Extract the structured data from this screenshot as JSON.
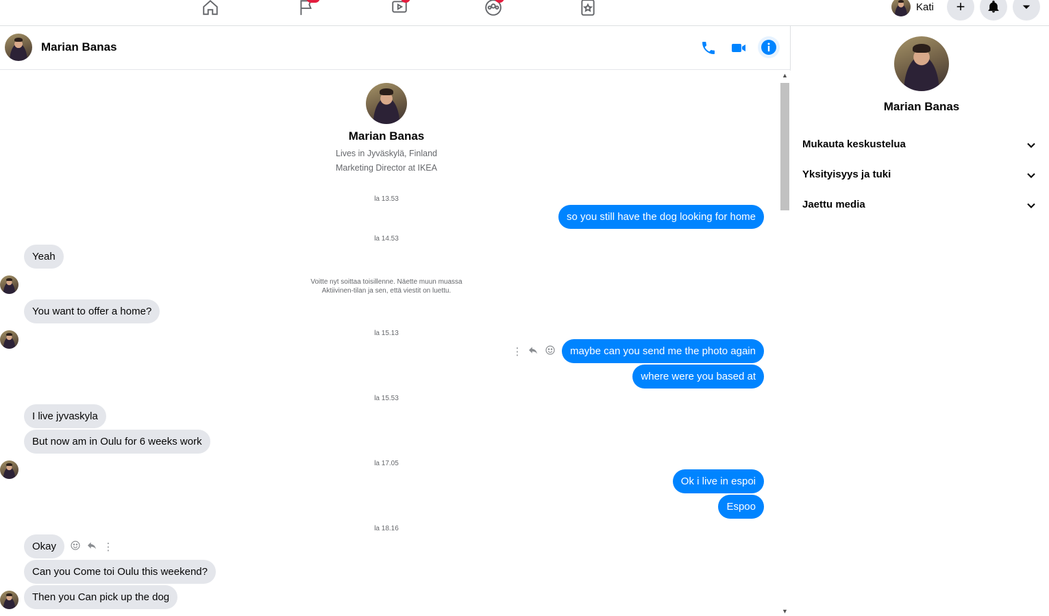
{
  "topnav": {
    "badges": {
      "pages": "",
      "watch": "",
      "groups": ""
    },
    "user_name": "Kati",
    "plus_label": "+"
  },
  "chat": {
    "contact_name": "Marian Banas",
    "intro": {
      "name": "Marian Banas",
      "lives": "Lives in Jyväskylä, Finland",
      "work": "Marketing Director at IKEA"
    },
    "timestamps": [
      "la 13.53",
      "la 14.53",
      "la 15.13",
      "la 15.53",
      "la 17.05",
      "la 18.16"
    ],
    "system_note": [
      "Voitte nyt soittaa toisillenne. Näette muun muassa",
      "Aktiivinen-tilan ja sen, että viestit on luettu."
    ],
    "messages": {
      "m1": "so you still have the dog looking for home",
      "m2": "Yeah",
      "m3": "You want to offer a home?",
      "m4": "maybe can you send me the photo again",
      "m5": "where were you based at",
      "m6": "I live jyvaskyla",
      "m7": "But now am in Oulu for 6 weeks work",
      "m8": "Ok i live in espoi",
      "m9": "Espoo",
      "m10": "Okay",
      "m11": "Can you Come toi Oulu this weekend?",
      "m12": "Then you Can pick up the dog"
    }
  },
  "panel": {
    "name": "Marian Banas",
    "sections": [
      "Mukauta keskustelua",
      "Yksityisyys ja tuki",
      "Jaettu media"
    ]
  },
  "colors": {
    "accent": "#0084ff",
    "incoming": "#e4e6eb"
  }
}
